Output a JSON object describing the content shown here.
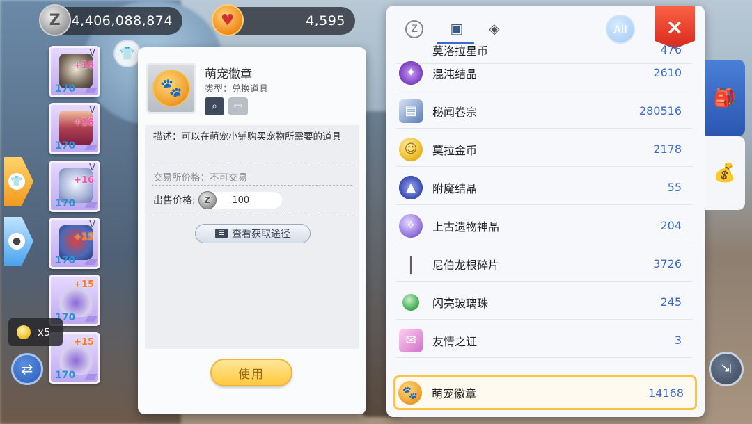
{
  "currencies": {
    "zeny": {
      "icon": "zeny-coin-icon",
      "value": "4,406,088,874"
    },
    "pet_coin": {
      "icon": "pet-coin-icon",
      "value": "4,595"
    }
  },
  "equipment": [
    {
      "level": "170",
      "plus": "+16",
      "tier": "V",
      "plus_color": "pink"
    },
    {
      "level": "170",
      "plus": "+16",
      "tier": "V",
      "plus_color": "pink"
    },
    {
      "level": "170",
      "plus": "+16",
      "tier": "V",
      "plus_color": "pink"
    },
    {
      "level": "170",
      "plus": "+15",
      "tier": "V",
      "plus_color": "orange"
    },
    {
      "level": "170",
      "plus": "+15",
      "tier": "",
      "plus_color": "orange"
    },
    {
      "level": "170",
      "plus": "+15",
      "tier": "",
      "plus_color": "orange"
    }
  ],
  "gold_tip": {
    "count": "x5"
  },
  "detail": {
    "name": "萌宠徽章",
    "type": "类型：兑换道具",
    "description": "描述：可以在萌宠小铺购买宠物所需要的道具",
    "trade_price": "交易所价格：不可交易",
    "sell_label": "出售价格:",
    "sell_price": "100",
    "route_button": "查看获取途径",
    "use_button": "使用"
  },
  "inventory": {
    "all_label": "All",
    "close_label": "×",
    "partial": {
      "name": "莫洛拉星币",
      "value": "476"
    },
    "items": [
      {
        "name": "混沌结晶",
        "value": "2610",
        "icon": "chaos-crystal-icon",
        "color": "#7a3fc0"
      },
      {
        "name": "秘闻卷宗",
        "value": "280516",
        "icon": "scroll-icon",
        "color": "#5a7ab8"
      },
      {
        "name": "莫拉金币",
        "value": "2178",
        "icon": "gold-coin-icon",
        "color": "#e8b418"
      },
      {
        "name": "附魔结晶",
        "value": "55",
        "icon": "enchant-crystal-icon",
        "color": "#3a4ab0"
      },
      {
        "name": "上古遗物神晶",
        "value": "204",
        "icon": "ancient-relic-icon",
        "color": "#8a6ad8"
      },
      {
        "name": "尼伯龙根碎片",
        "value": "3726",
        "icon": "shard-icon",
        "color": "#6a5a5a"
      },
      {
        "name": "闪亮玻璃珠",
        "value": "245",
        "icon": "glass-bead-icon",
        "color": "#3aa84a"
      },
      {
        "name": "友情之证",
        "value": "3",
        "icon": "friendship-icon",
        "color": "#d070c8"
      },
      {
        "name": "萌宠徽章",
        "value": "14168",
        "icon": "pet-badge-icon",
        "color": "#f0a030",
        "selected": true
      }
    ]
  },
  "colors": {
    "accent_blue": "#3a6cc8",
    "selected_border": "#ffc13e",
    "close_red": "#d8281c"
  }
}
